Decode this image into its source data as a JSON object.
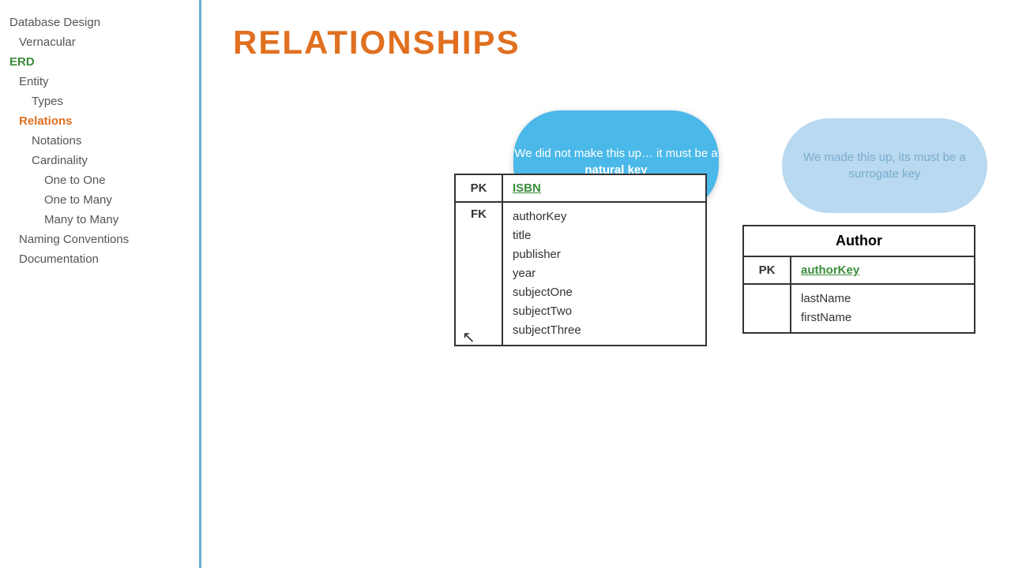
{
  "sidebar": {
    "items": [
      {
        "label": "Database Design",
        "level": 0,
        "state": "normal"
      },
      {
        "label": "Vernacular",
        "level": 1,
        "state": "normal"
      },
      {
        "label": "ERD",
        "level": 0,
        "state": "green"
      },
      {
        "label": "Entity",
        "level": 1,
        "state": "normal"
      },
      {
        "label": "Types",
        "level": 2,
        "state": "normal"
      },
      {
        "label": "Relations",
        "level": 1,
        "state": "active"
      },
      {
        "label": "Notations",
        "level": 2,
        "state": "normal"
      },
      {
        "label": "Cardinality",
        "level": 2,
        "state": "normal"
      },
      {
        "label": "One to One",
        "level": 3,
        "state": "normal"
      },
      {
        "label": "One to Many",
        "level": 3,
        "state": "normal"
      },
      {
        "label": "Many to Many",
        "level": 3,
        "state": "normal"
      },
      {
        "label": "Naming Conventions",
        "level": 1,
        "state": "normal"
      },
      {
        "label": "Documentation",
        "level": 1,
        "state": "normal"
      }
    ]
  },
  "main": {
    "title": "RELATIONSHIPS",
    "cloud_left_text": "We did not make this up… it must be a natural key",
    "cloud_left_bold": "natural key",
    "cloud_right_text": "We made this up, its must be a surrogate key",
    "table_left": {
      "pk_key": "PK",
      "pk_value": "ISBN",
      "fk_key": "FK",
      "fields": [
        "authorKey",
        "title",
        "publisher",
        "year",
        "subjectOne",
        "subjectTwo",
        "subjectThree"
      ]
    },
    "table_right": {
      "title": "Author",
      "pk_key": "PK",
      "pk_value": "authorKey",
      "fields": [
        "lastName",
        "firstName"
      ]
    }
  }
}
